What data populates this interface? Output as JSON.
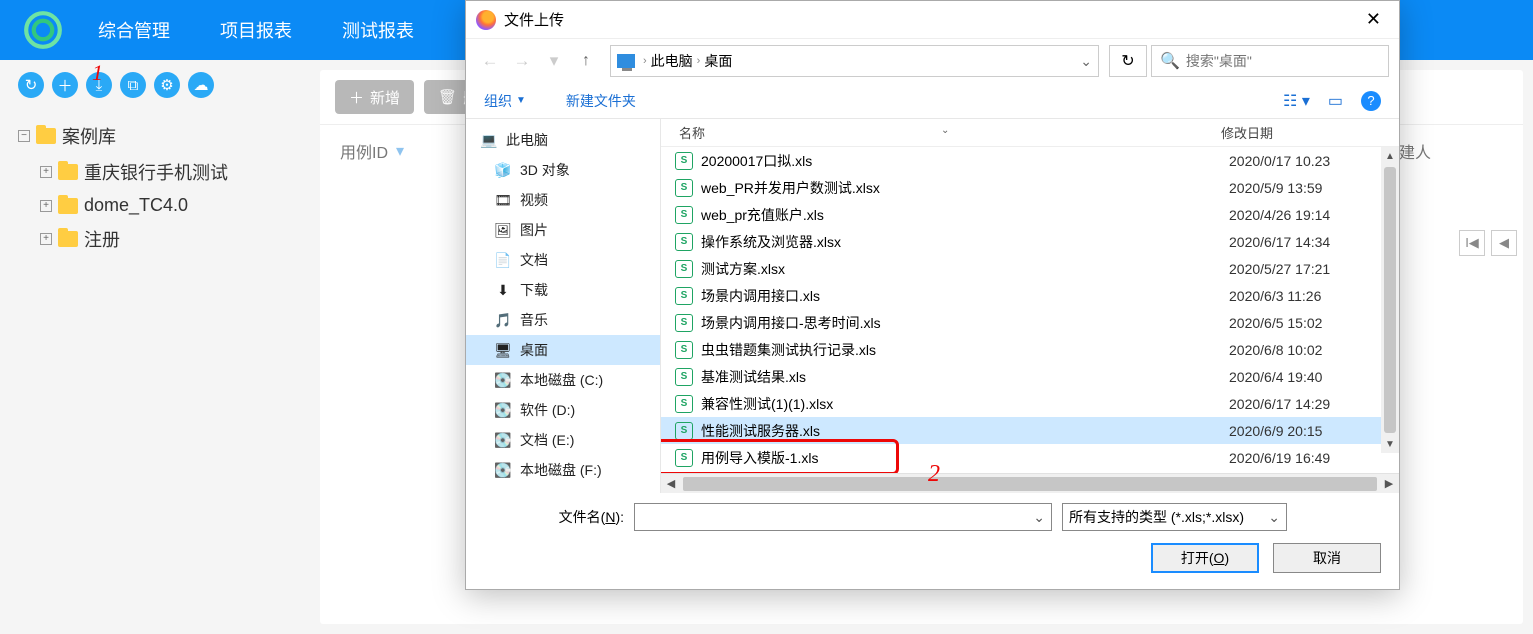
{
  "nav": {
    "m1": "综合管理",
    "m2": "项目报表",
    "m3": "测试报表"
  },
  "toolbar_icons": [
    "↻",
    "＋",
    "⤓",
    "⧉",
    "⚙",
    "☁"
  ],
  "annotations": {
    "one": "1",
    "two": "2"
  },
  "tree": {
    "root": "案例库",
    "c1": "重庆银行手机测试",
    "c2": "dome_TC4.0",
    "c3": "注册"
  },
  "main": {
    "add": "新增",
    "del": "删",
    "col_id": "用例ID",
    "col_creator": "创建人"
  },
  "dialog": {
    "title": "文件上传",
    "crumb1": "此电脑",
    "crumb2": "桌面",
    "search_ph": "搜索\"桌面\"",
    "organize": "组织",
    "newfolder": "新建文件夹",
    "col_name": "名称",
    "col_date": "修改日期",
    "side": {
      "pc": "此电脑",
      "s3d": "3D 对象",
      "svid": "视频",
      "simg": "图片",
      "sdoc": "文档",
      "sdl": "下载",
      "smus": "音乐",
      "sdesk": "桌面",
      "sdc": "本地磁盘 (C:)",
      "sdd": "软件 (D:)",
      "sde": "文档 (E:)",
      "sdf": "本地磁盘 (F:)"
    },
    "files": [
      {
        "n": "20200017口拟.xls",
        "d": "2020/0/17 10.23"
      },
      {
        "n": "web_PR并发用户数测试.xlsx",
        "d": "2020/5/9 13:59"
      },
      {
        "n": "web_pr充值账户.xls",
        "d": "2020/4/26 19:14"
      },
      {
        "n": "操作系统及浏览器.xlsx",
        "d": "2020/6/17 14:34"
      },
      {
        "n": "测试方案.xlsx",
        "d": "2020/5/27 17:21"
      },
      {
        "n": "场景内调用接口.xls",
        "d": "2020/6/3 11:26"
      },
      {
        "n": "场景内调用接口-思考时间.xls",
        "d": "2020/6/5 15:02"
      },
      {
        "n": "虫虫错题集测试执行记录.xls",
        "d": "2020/6/8 10:02"
      },
      {
        "n": "基准测试结果.xls",
        "d": "2020/6/4 19:40"
      },
      {
        "n": "兼容性测试(1)(1).xlsx",
        "d": "2020/6/17 14:29"
      },
      {
        "n": "性能测试服务器.xls",
        "d": "2020/6/9 20:15"
      },
      {
        "n": "用例导入模版-1.xls",
        "d": "2020/6/19 16:49"
      }
    ],
    "fn_label_a": "文件名(",
    "fn_label_u": "N",
    "fn_label_b": "):",
    "filetype": "所有支持的类型 (*.xls;*.xlsx)",
    "open_a": "打开(",
    "open_u": "O",
    "open_b": ")",
    "cancel": "取消"
  }
}
